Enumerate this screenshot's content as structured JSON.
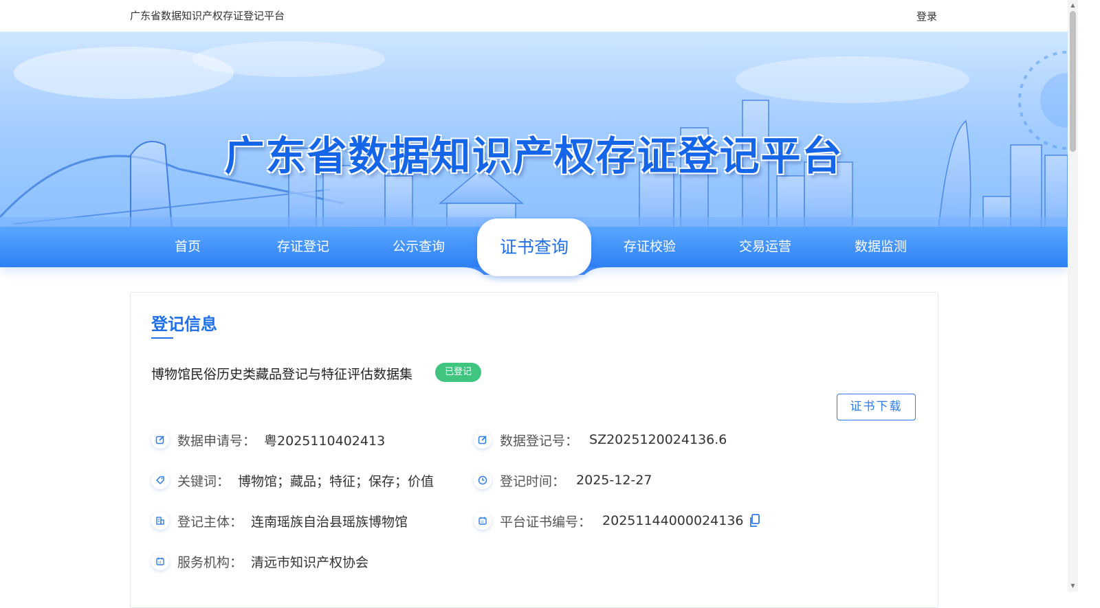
{
  "header": {
    "site_name": "广东省数据知识产权存证登记平台",
    "login_label": "登录"
  },
  "banner": {
    "title": "广东省数据知识产权存证登记平台"
  },
  "nav": {
    "items": [
      "首页",
      "存证登记",
      "公示查询",
      "证书查询",
      "存证校验",
      "交易运营",
      "数据监测"
    ],
    "active": "证书查询"
  },
  "record": {
    "section_title": "登记信息",
    "dataset_name": "博物馆民俗历史类藏品登记与特征评估数据集",
    "status": "已登记",
    "download_label": "证书下载",
    "fields": {
      "application_no": {
        "label": "数据申请号：",
        "value": "粤2025110402413"
      },
      "registration_no": {
        "label": "数据登记号：",
        "value": "SZ2025120024136.6"
      },
      "keywords": {
        "label": "关键词：",
        "value": "博物馆；藏品；特征；保存；价值"
      },
      "registration_time": {
        "label": "登记时间：",
        "value": "2025-12-27"
      },
      "registrant": {
        "label": "登记主体：",
        "value": "连南瑶族自治县瑶族博物馆"
      },
      "certificate_no": {
        "label": "平台证书编号：",
        "value": "20251144000024136"
      },
      "service_agency": {
        "label": "服务机构：",
        "value": "清远市知识产权协会"
      }
    }
  },
  "colors": {
    "accent": "#1e6fe8",
    "nav_gradient_top": "#5aa7ff",
    "nav_gradient_bottom": "#2f80f5",
    "status_green": "#3fc57f"
  }
}
